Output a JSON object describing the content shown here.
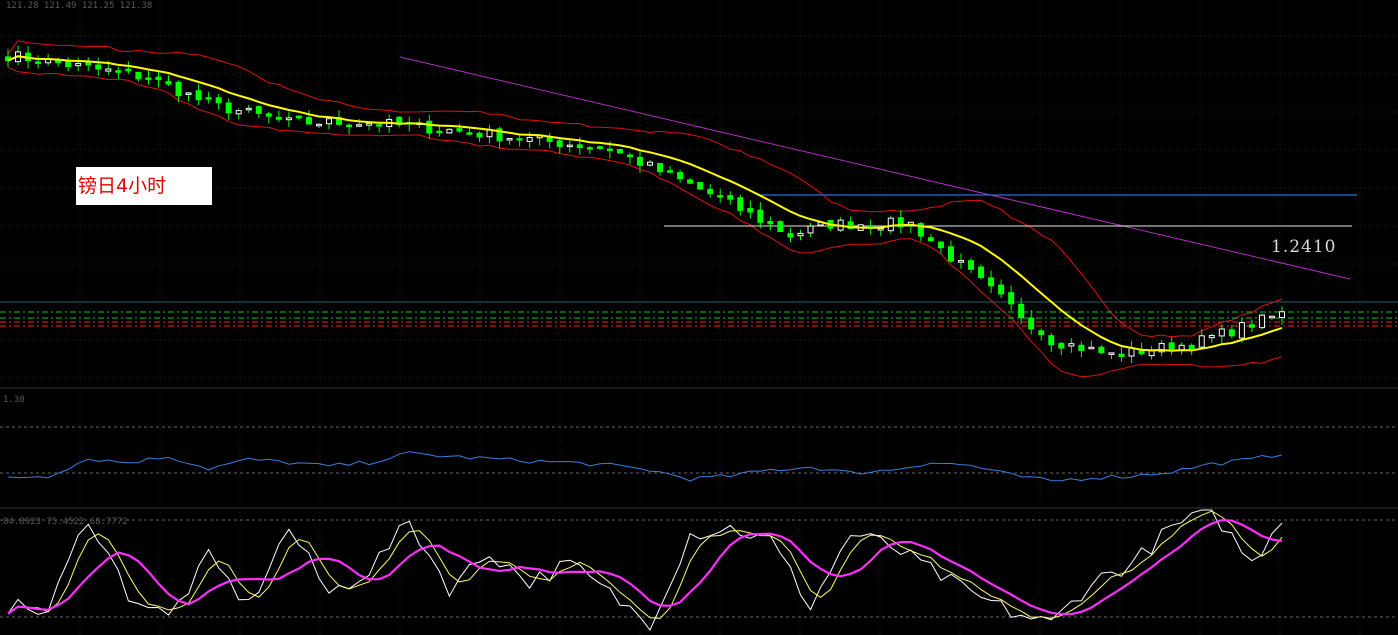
{
  "chart_label": "镑日4小时",
  "price_label": "1.2410",
  "ohlc_header": "121.28 121.49 121.25 121.38",
  "rsi_header": "1.30",
  "stoch_header": "84.8923 75.4522 68.7772",
  "colors": {
    "background": "#000000",
    "bull_candle": "#ffffff",
    "bear_candle": "#00ff00",
    "ma": "#ffff00",
    "bollinger": "#e01010",
    "trendline": "#b030c0",
    "upper_hline": "#2a6fd6",
    "lower_hline": "#e8e8e8",
    "rsi": "#3a7fe0",
    "stoch_k": "#ffffff",
    "stoch_d": "#ffff66",
    "stoch_slow": "#ff30ff",
    "level_green": "#00cc33",
    "level_red": "#ff2020"
  },
  "chart_data": [
    {
      "type": "candlestick",
      "title": "镑日4小时",
      "annotations": [
        "1.2410"
      ],
      "ylim": [
        0,
        100
      ],
      "candle_count": 128,
      "anchors_x": [
        0,
        14,
        20,
        28,
        36,
        44,
        60,
        70,
        78,
        82,
        90,
        104,
        110,
        118,
        127
      ],
      "anchors_y": [
        88,
        82,
        75,
        70,
        70,
        68,
        63,
        51,
        40,
        43,
        43,
        12,
        8,
        11,
        19
      ],
      "seed": 7
    },
    {
      "type": "line",
      "ylim": [
        0,
        100
      ],
      "x": [
        0,
        4,
        8,
        12,
        16,
        20,
        24,
        28,
        32,
        36,
        40,
        44,
        48,
        52,
        56,
        60,
        64,
        68,
        72,
        76,
        80,
        84,
        88,
        92,
        96,
        100,
        104,
        108,
        112,
        116,
        120,
        124,
        127
      ],
      "values": [
        30,
        32,
        55,
        50,
        58,
        42,
        54,
        50,
        45,
        50,
        62,
        58,
        55,
        52,
        50,
        46,
        40,
        28,
        32,
        40,
        44,
        36,
        40,
        50,
        46,
        33,
        25,
        30,
        32,
        38,
        48,
        54,
        62
      ]
    },
    {
      "type": "line",
      "ylim": [
        0,
        100
      ],
      "levels": [
        80,
        20
      ],
      "k": [
        20,
        15,
        95,
        30,
        10,
        60,
        20,
        85,
        30,
        50,
        90,
        35,
        65,
        40,
        55,
        30,
        5,
        80,
        85,
        75,
        20,
        80,
        70,
        50,
        30,
        15,
        5,
        40,
        55,
        85,
        100,
        55,
        95
      ],
      "x": [
        0,
        4,
        8,
        12,
        16,
        20,
        24,
        28,
        32,
        36,
        40,
        44,
        48,
        52,
        56,
        60,
        64,
        68,
        72,
        76,
        80,
        84,
        88,
        92,
        96,
        100,
        104,
        108,
        112,
        116,
        120,
        124,
        127
      ]
    }
  ]
}
